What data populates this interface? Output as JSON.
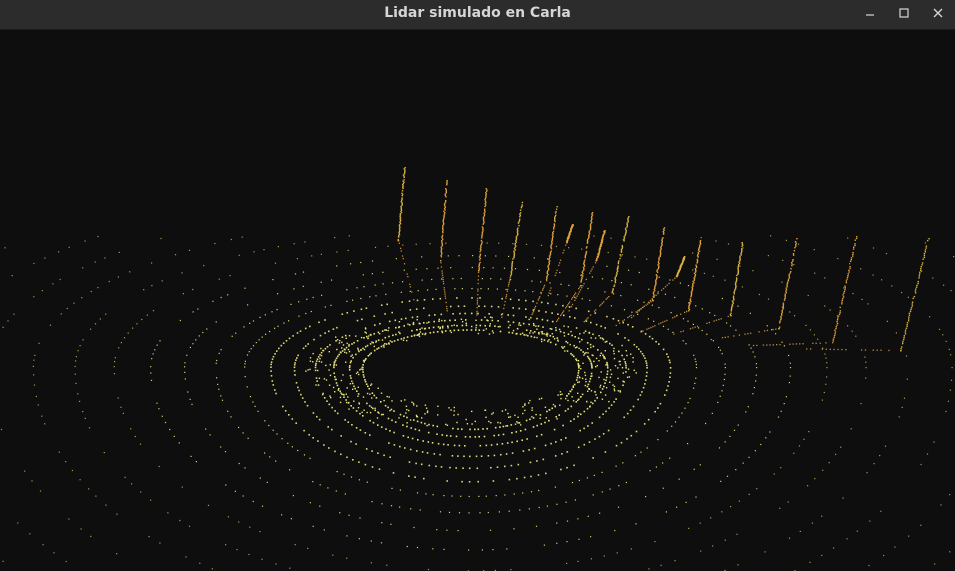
{
  "window": {
    "title": "Lidar simulado en Carla",
    "controls": {
      "minimize_icon": "minimize-icon",
      "maximize_icon": "maximize-icon",
      "close_icon": "close-icon"
    }
  },
  "viewport": {
    "background": "#0e0e0e",
    "ground_point_color": "#e8e37a",
    "ground_point_dim_color": "#b9b35a",
    "obstacle_point_color": "#e0a23a",
    "obstacle_point_alt_color": "#d9b340"
  }
}
